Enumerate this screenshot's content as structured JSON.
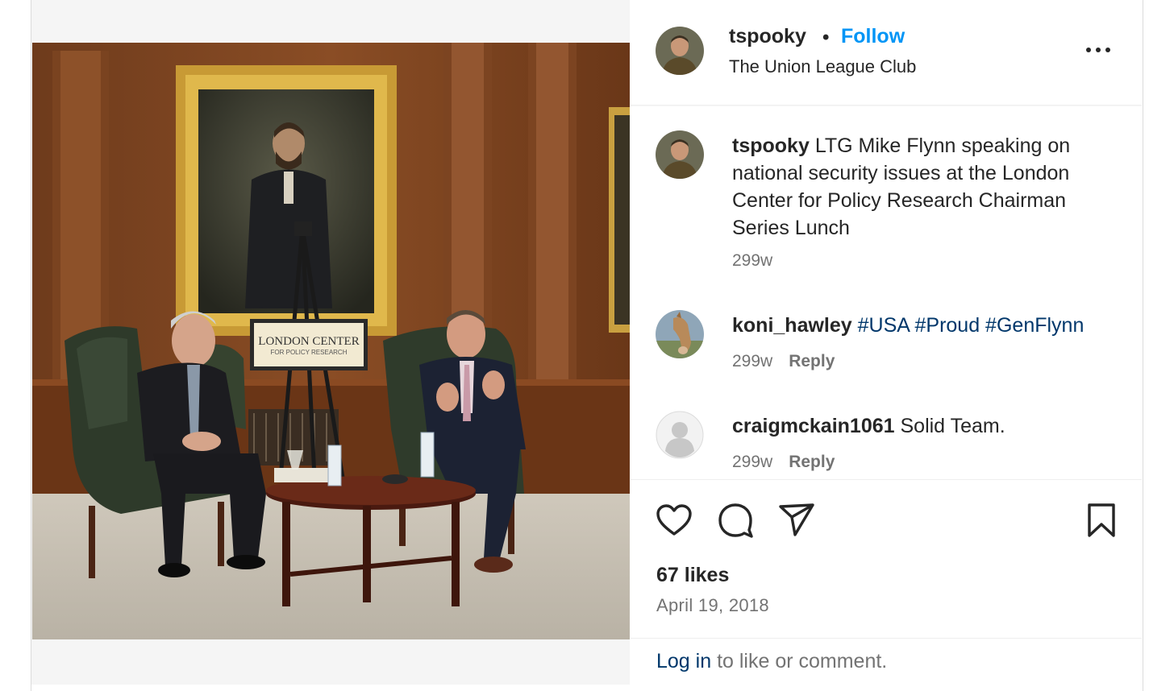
{
  "post": {
    "username": "tspooky",
    "separator": "•",
    "follow_label": "Follow",
    "location": "The Union League Club",
    "caption": "LTG Mike Flynn speaking on national security issues at the London Center for Policy Research Chairman Series Lunch",
    "caption_age": "299w",
    "likes": "67 likes",
    "date": "April 19, 2018"
  },
  "photo": {
    "sign_line1": "LONDON CENTER",
    "sign_line2": "FOR POLICY RESEARCH"
  },
  "comments": [
    {
      "username": "koni_hawley",
      "tags": "#USA #Proud #GenFlynn",
      "age": "299w",
      "reply_label": "Reply"
    },
    {
      "username": "craigmckain1061",
      "text": "Solid Team.",
      "age": "299w",
      "reply_label": "Reply"
    }
  ],
  "footer": {
    "login_label": "Log in",
    "login_suffix": " to like or comment."
  },
  "icons": {
    "more": "more-options-icon",
    "like": "heart-icon",
    "comment": "comment-icon",
    "share": "share-icon",
    "save": "bookmark-icon"
  },
  "colors": {
    "follow": "#0095f6",
    "link": "#00376b",
    "muted": "#737373",
    "text": "#262626"
  }
}
